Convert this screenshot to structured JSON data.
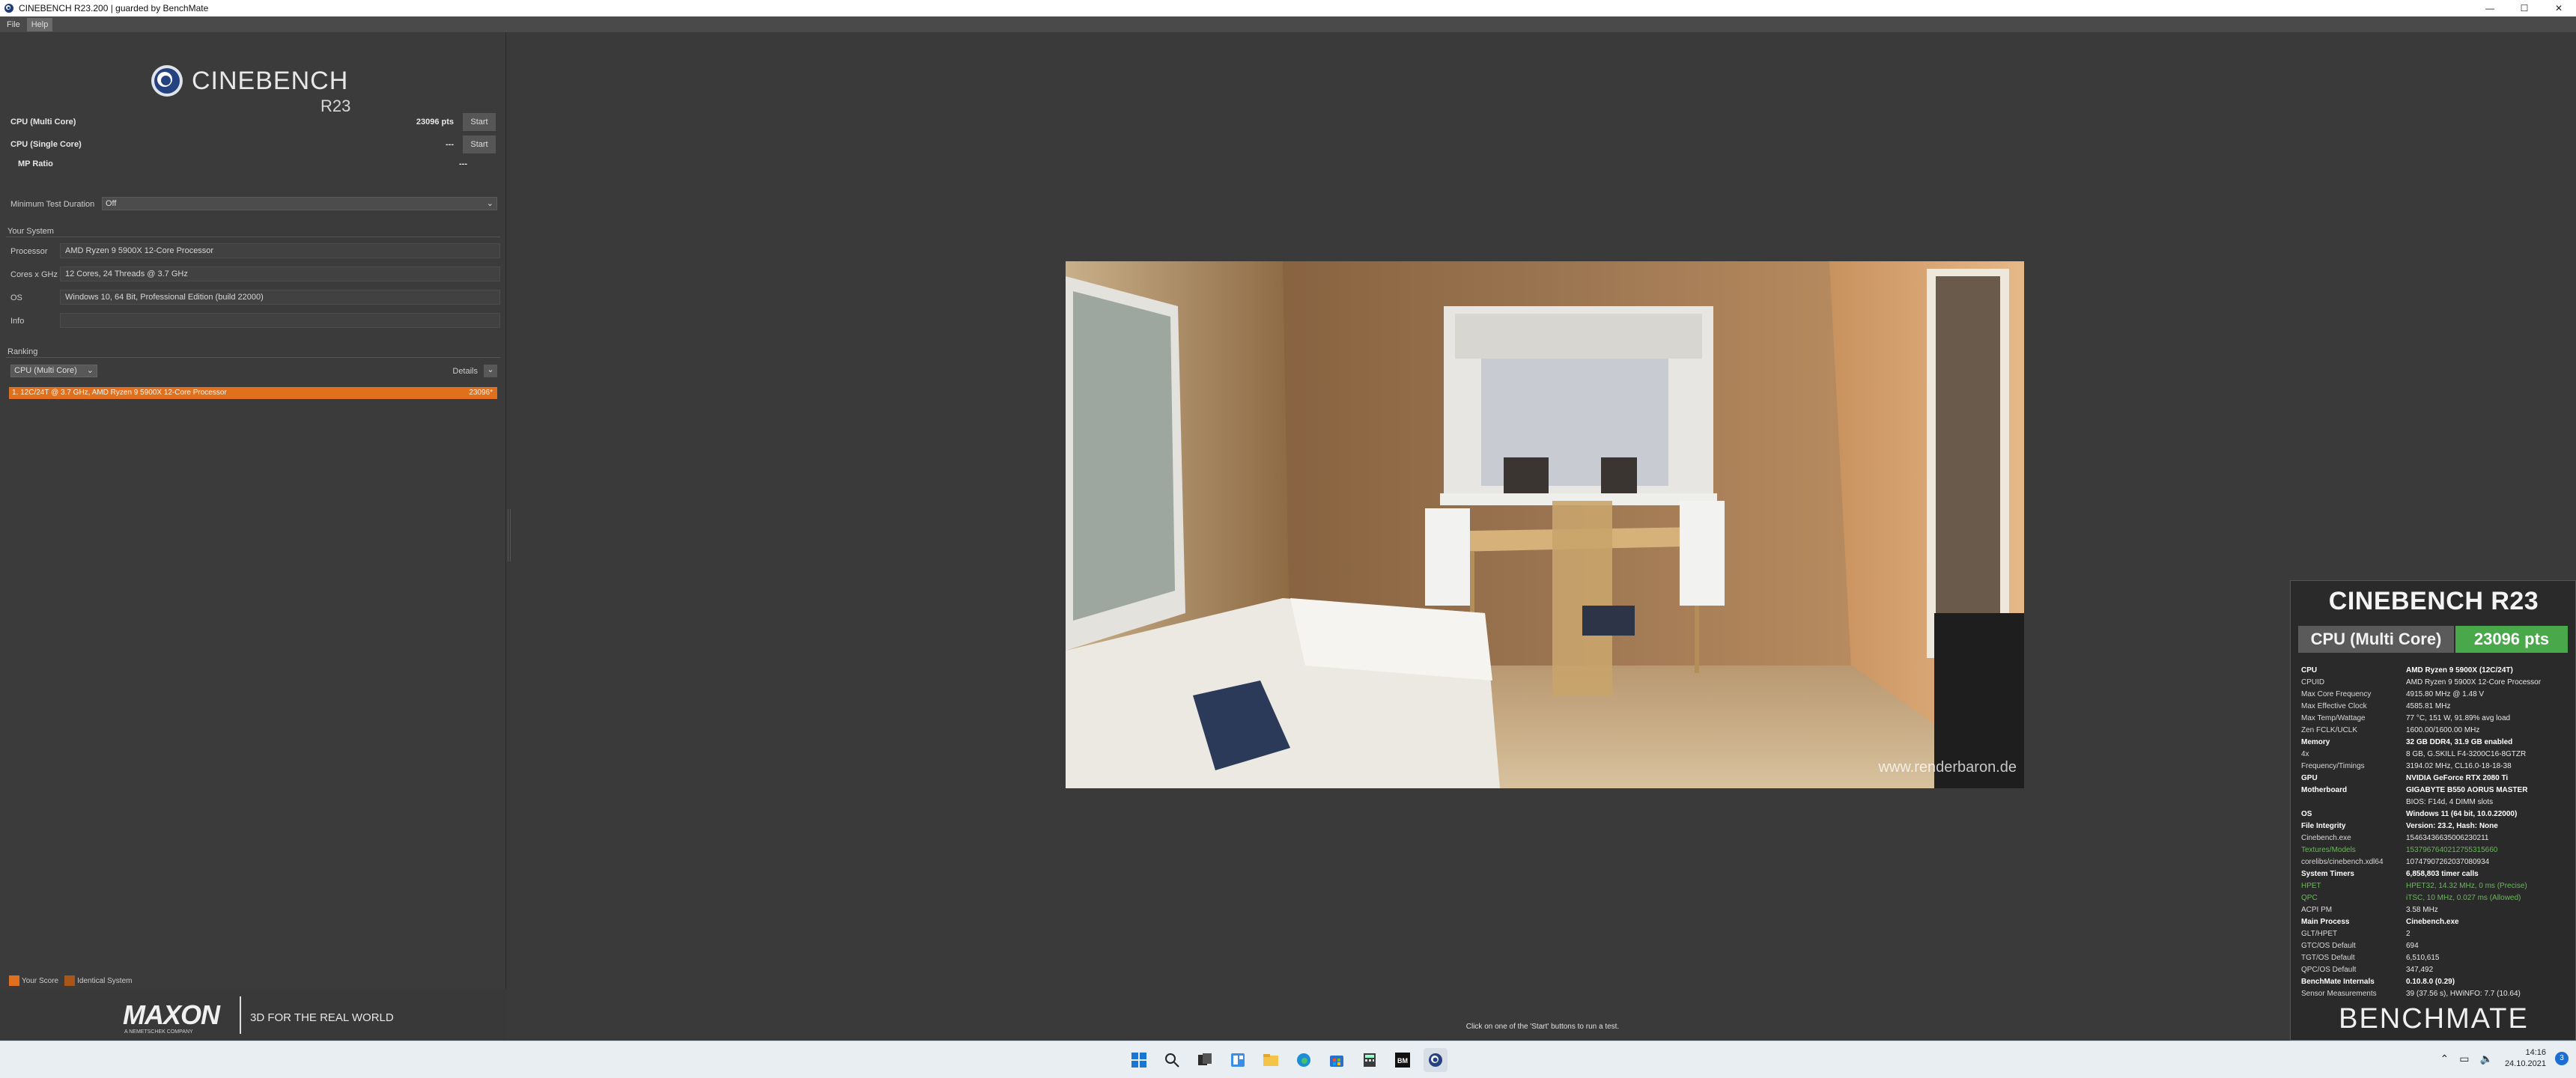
{
  "window": {
    "title": "CINEBENCH R23.200 | guarded by BenchMate",
    "minimize": "—",
    "maximize": "☐",
    "close": "✕"
  },
  "menu": {
    "file": "File",
    "help": "Help"
  },
  "logo": {
    "brand": "CINEBENCH",
    "version": "R23"
  },
  "tests": {
    "multi": {
      "label": "CPU (Multi Core)",
      "score": "23096 pts",
      "button": "Start"
    },
    "single": {
      "label": "CPU (Single Core)",
      "score": "---",
      "button": "Start"
    },
    "mp_ratio": {
      "label": "MP Ratio",
      "value": "---"
    }
  },
  "min_test_duration": {
    "label": "Minimum Test Duration",
    "value": "Off"
  },
  "your_system": {
    "title": "Your System",
    "rows": [
      {
        "key": "Processor",
        "value": "AMD Ryzen 9 5900X 12-Core Processor"
      },
      {
        "key": "Cores x GHz",
        "value": "12 Cores, 24 Threads @ 3.7 GHz"
      },
      {
        "key": "OS",
        "value": "Windows 10, 64 Bit, Professional Edition (build 22000)"
      },
      {
        "key": "Info",
        "value": ""
      }
    ]
  },
  "ranking": {
    "title": "Ranking",
    "mode": "CPU (Multi Core)",
    "details": "Details",
    "entry_label": "1. 12C/24T @ 3.7 GHz, AMD Ryzen 9 5900X 12-Core Processor",
    "entry_score": "23096*"
  },
  "legend": {
    "your_score": "Your Score",
    "identical": "Identical System"
  },
  "maxon": {
    "logo": "MAXON",
    "sub": "A NEMETSCHEK COMPANY",
    "tagline": "3D FOR THE REAL WORLD"
  },
  "render": {
    "watermark": "www.renderbaron.de"
  },
  "status_text": "Click on one of the 'Start' buttons to run a test.",
  "benchmate": {
    "title": "CINEBENCH R23",
    "mode": "CPU (Multi Core)",
    "score": "23096 pts",
    "rows": [
      {
        "k": "CPU",
        "v": "AMD Ryzen 9 5900X (12C/24T)",
        "style": "hdr"
      },
      {
        "k": "CPUID",
        "v": "AMD Ryzen 9 5900X 12-Core Processor",
        "style": ""
      },
      {
        "k": "Max Core Frequency",
        "v": "4915.80 MHz @ 1.48 V",
        "style": ""
      },
      {
        "k": "Max Effective Clock",
        "v": "4585.81 MHz",
        "style": ""
      },
      {
        "k": "Max Temp/Wattage",
        "v": "77 °C, 151 W, 91.89% avg load",
        "style": ""
      },
      {
        "k": "Zen FCLK/UCLK",
        "v": "1600.00/1600.00 MHz",
        "style": ""
      },
      {
        "k": "Memory",
        "v": "32 GB DDR4, 31.9 GB enabled",
        "style": "hdr"
      },
      {
        "k": "4x",
        "v": "8 GB, G.SKILL F4-3200C16-8GTZR",
        "style": ""
      },
      {
        "k": "Frequency/Timings",
        "v": "3194.02 MHz, CL16.0-18-18-38",
        "style": ""
      },
      {
        "k": "GPU",
        "v": "NVIDIA GeForce RTX 2080 Ti",
        "style": "hdr"
      },
      {
        "k": "Motherboard",
        "v": "GIGABYTE B550 AORUS MASTER",
        "style": "hdr"
      },
      {
        "k": "",
        "v": "BIOS: F14d, 4 DIMM slots",
        "style": ""
      },
      {
        "k": "OS",
        "v": "Windows 11 (64 bit, 10.0.22000)",
        "style": "hdr"
      },
      {
        "k": "File Integrity",
        "v": "Version: 23.2, Hash: None",
        "style": "hdr"
      },
      {
        "k": "Cinebench.exe",
        "v": "15463436635006230211",
        "style": ""
      },
      {
        "k": "Textures/Models",
        "v": "1537967640212755315660",
        "style": "green"
      },
      {
        "k": "corelibs/cinebench.xdl64",
        "v": "10747907262037080934",
        "style": ""
      },
      {
        "k": "System Timers",
        "v": "6,858,803 timer calls",
        "style": "hdr"
      },
      {
        "k": "HPET",
        "v": "HPET32, 14.32 MHz, 0 ms (Precise)",
        "style": "green"
      },
      {
        "k": "QPC",
        "v": "iTSC, 10 MHz, 0.027 ms (Allowed)",
        "style": "green"
      },
      {
        "k": "ACPI PM",
        "v": "3.58 MHz",
        "style": ""
      },
      {
        "k": "Main Process",
        "v": "Cinebench.exe",
        "style": "hdr"
      },
      {
        "k": "GLT/HPET",
        "v": "2",
        "style": ""
      },
      {
        "k": "GTC/OS Default",
        "v": "694",
        "style": ""
      },
      {
        "k": "TGT/OS Default",
        "v": "6,510,615",
        "style": ""
      },
      {
        "k": "QPC/OS Default",
        "v": "347,492",
        "style": ""
      },
      {
        "k": "BenchMate Internals",
        "v": "0.10.8.0 (0.29)",
        "style": "hdr"
      },
      {
        "k": "Sensor Measurements",
        "v": "39 (37.56 s), HWiNFO: 7.7 (10.64)",
        "style": ""
      }
    ],
    "footer": "BENCHMATE"
  },
  "taskbar": {
    "icons": [
      "windows-start-icon",
      "search-icon",
      "task-view-icon",
      "widgets-icon",
      "file-explorer-icon",
      "edge-icon",
      "store-icon",
      "calculator-icon",
      "benchmate-icon",
      "cinebench-icon"
    ],
    "time": "14:16",
    "date": "24.10.2021",
    "notifications": "3"
  }
}
